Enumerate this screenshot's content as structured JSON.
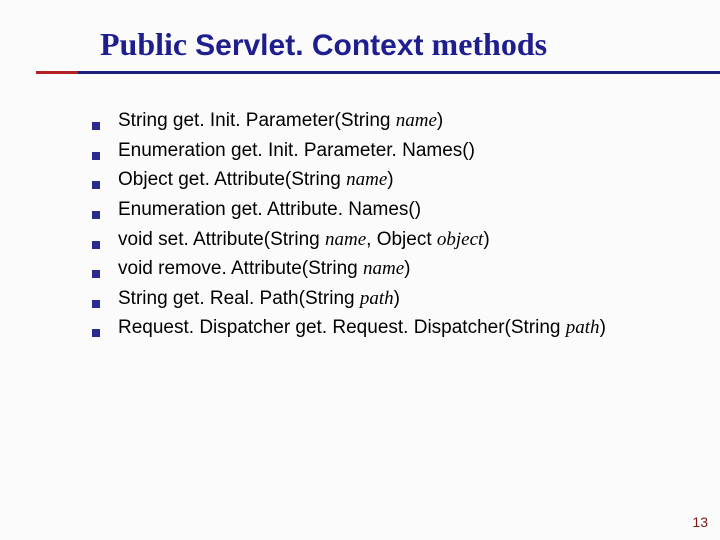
{
  "title": {
    "pre": "Public ",
    "mono": "Servlet. Context",
    "post": " methods"
  },
  "items": [
    {
      "ret": "String ",
      "name": "get. Init. Parameter(String ",
      "param": "name",
      "tail": ")"
    },
    {
      "ret": "Enumeration ",
      "name": "get. Init. Parameter. Names()",
      "param": "",
      "tail": ""
    },
    {
      "ret": "Object ",
      "name": "get. Attribute(String ",
      "param": "name",
      "tail": ")"
    },
    {
      "ret": "Enumeration ",
      "name": "get. Attribute. Names()",
      "param": "",
      "tail": ""
    },
    {
      "ret": "void ",
      "name": "set. Attribute(String ",
      "param": "name",
      "mid": ", Object ",
      "param2": "object",
      "tail": ")"
    },
    {
      "ret": "void ",
      "name": "remove. Attribute(String ",
      "param": "name",
      "tail": ")"
    },
    {
      "ret": "String ",
      "name": "get. Real. Path(String ",
      "param": "path",
      "tail": ")"
    },
    {
      "ret": "Request. Dispatcher ",
      "name": "get. Request. Dispatcher(String ",
      "param": "path",
      "tail": ")"
    }
  ],
  "page": "13"
}
